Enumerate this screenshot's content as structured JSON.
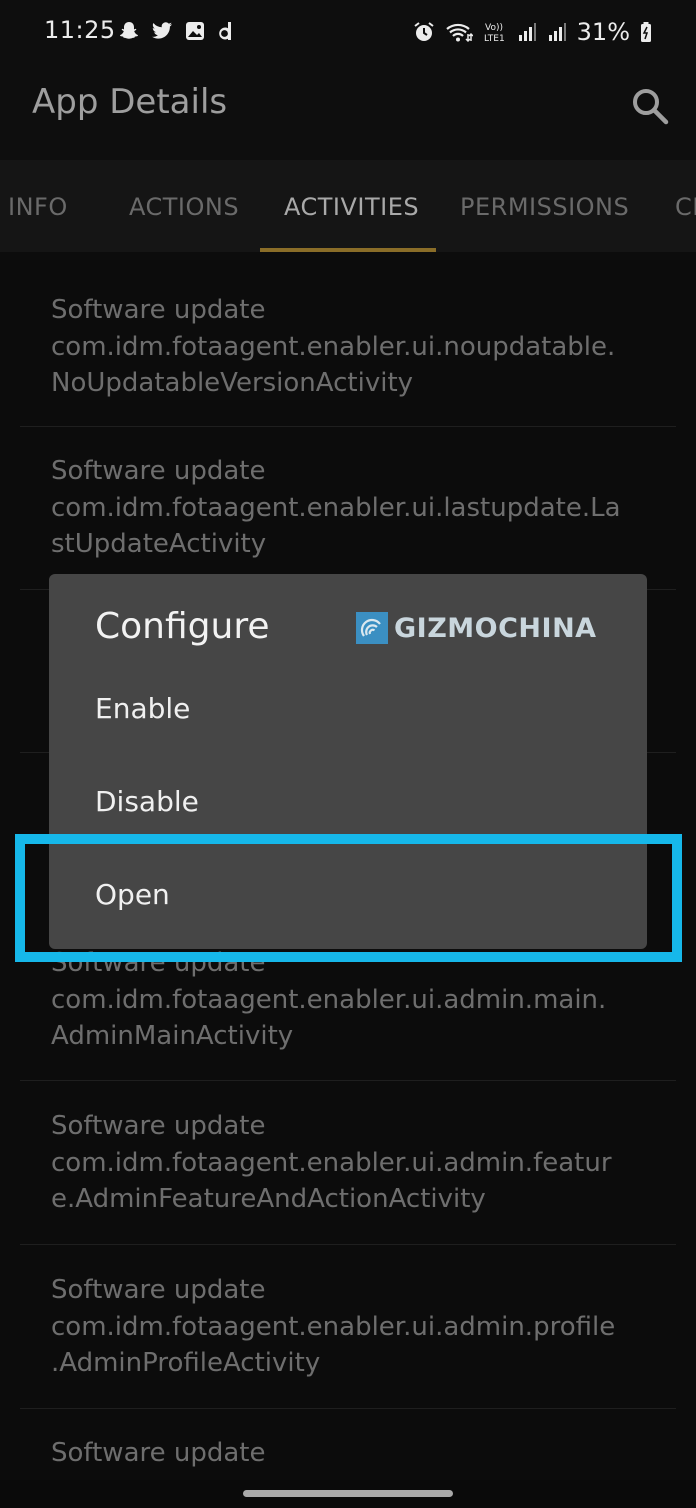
{
  "status_bar": {
    "time": "11:25",
    "battery": "31%",
    "left_icons": [
      "snapchat-icon",
      "twitter-icon",
      "gallery-icon",
      "dailyhunt-icon"
    ],
    "right_icons": [
      "alarm-icon",
      "wifi-icon",
      "volte-icon",
      "signal-icon",
      "signal-icon",
      "battery-icon"
    ]
  },
  "app_bar": {
    "title": "App Details",
    "search_icon": "search-icon"
  },
  "tabs": [
    {
      "label": "INFO",
      "active": false
    },
    {
      "label": "ACTIONS",
      "active": false
    },
    {
      "label": "ACTIVITIES",
      "active": true
    },
    {
      "label": "PERMISSIONS",
      "active": false
    },
    {
      "label": "CE",
      "active": false
    }
  ],
  "activities": [
    {
      "line1": "Software update",
      "line2": "com.idm.fotaagent.enabler.ui.noupdatable.",
      "line3": "NoUpdatableVersionActivity"
    },
    {
      "line1": "Software update",
      "line2": "com.idm.fotaagent.enabler.ui.lastupdate.La",
      "line3": "stUpdateActivity"
    },
    {
      "line1": "Software update",
      "line2": "com.idm.fotaagent.enabler.ui.admin.main.",
      "line3": "AdminMainActivity"
    },
    {
      "line1": "Software update",
      "line2": "com.idm.fotaagent.enabler.ui.admin.featur",
      "line3": "e.AdminFeatureAndActionActivity"
    },
    {
      "line1": "Software update",
      "line2": "com.idm.fotaagent.enabler.ui.admin.profile",
      "line3": ".AdminProfileActivity"
    },
    {
      "line1": "Software update"
    }
  ],
  "dialog": {
    "title": "Configure",
    "options": [
      "Enable",
      "Disable",
      "Open"
    ],
    "highlighted_option": "Open"
  },
  "watermark": {
    "text": "GIZMOCHINA"
  },
  "colors": {
    "accent": "#8a6d28",
    "highlight": "#16b8ea",
    "dialog_bg": "#464646"
  }
}
